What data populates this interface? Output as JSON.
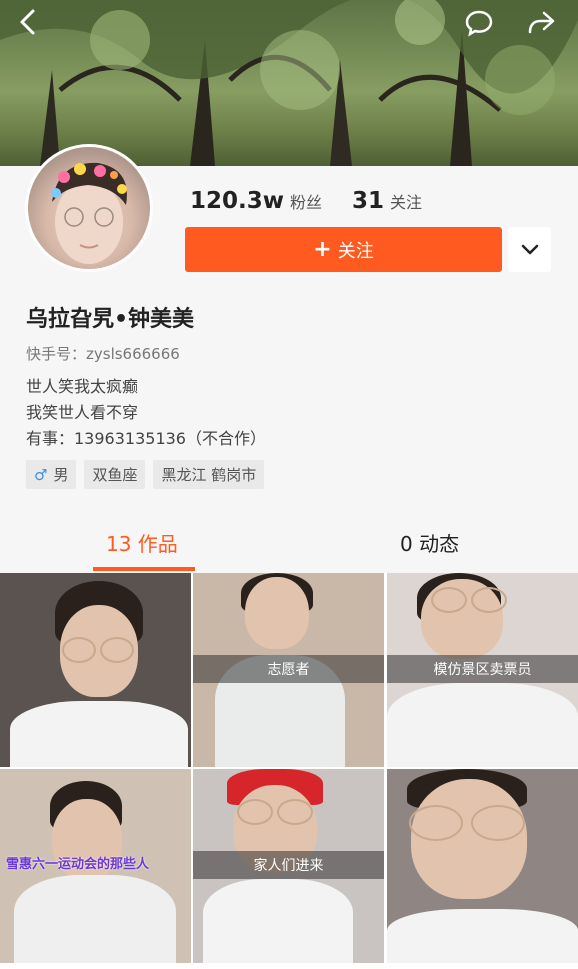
{
  "header": {
    "back_icon": "chevron-left-icon",
    "comment_icon": "speech-bubble-icon",
    "share_icon": "share-arrow-icon"
  },
  "profile": {
    "followers_count": "120.3w",
    "followers_label": "粉丝",
    "following_count": "31",
    "following_label": "关注",
    "follow_button_label": "关注",
    "follow_button_icon": "plus-icon",
    "more_icon": "chevron-down-icon",
    "name": "乌拉旮旯•钟美美",
    "kuaishou_id": "快手号：zysls666666",
    "bio_lines": [
      "世人笑我太疯癫",
      "我笑世人看不穿",
      "有事：13963135136（不合作）"
    ],
    "tags": {
      "gender": "男",
      "gender_icon": "male-symbol-icon",
      "zodiac": "双鱼座",
      "location": "黑龙江 鹤岗市"
    }
  },
  "tabs": {
    "works": "13 作品",
    "moments": "0 动态"
  },
  "videos": [
    {
      "caption": ""
    },
    {
      "caption": "志愿者"
    },
    {
      "caption": "模仿景区卖票员"
    },
    {
      "caption": "雪惠六一运动会的那些人"
    },
    {
      "caption": "家人们进来"
    },
    {
      "caption": ""
    }
  ],
  "colors": {
    "accent": "#ff5a1f",
    "background": "#f6f6f6"
  }
}
